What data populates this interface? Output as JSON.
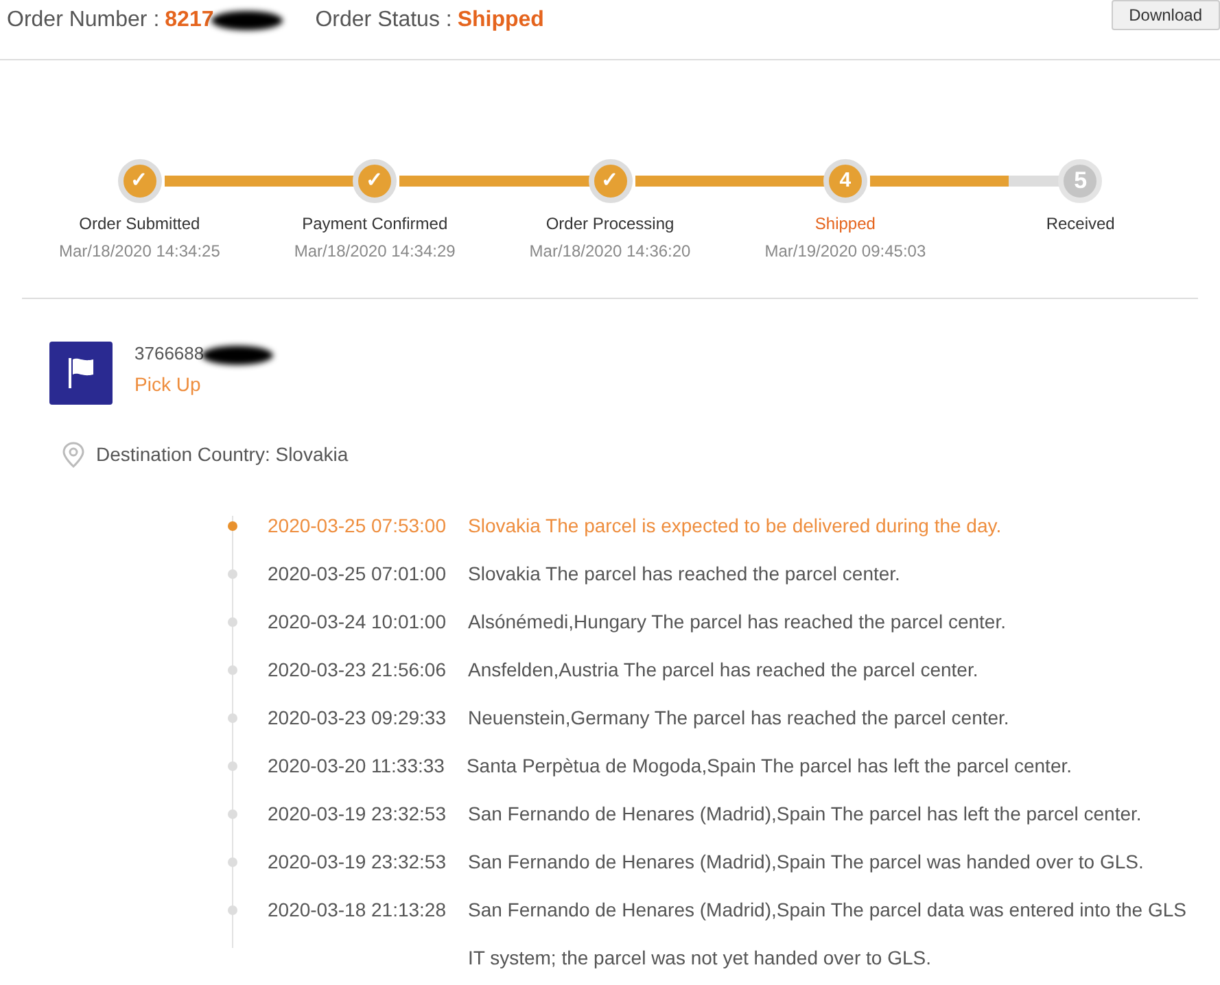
{
  "header": {
    "order_number_label": "Order Number :",
    "order_number": "8217",
    "order_status_label": "Order Status :",
    "order_status": "Shipped",
    "download_button": "Download"
  },
  "progress": {
    "steps": [
      {
        "marker": "✓",
        "label": "Order Submitted",
        "time": "Mar/18/2020 14:34:25",
        "selected": false
      },
      {
        "marker": "✓",
        "label": "Payment Confirmed",
        "time": "Mar/18/2020 14:34:29",
        "selected": false
      },
      {
        "marker": "✓",
        "label": "Order Processing",
        "time": "Mar/18/2020 14:36:20",
        "selected": false
      },
      {
        "marker": "4",
        "label": "Shipped",
        "time": "Mar/19/2020 09:45:03",
        "selected": true
      },
      {
        "marker": "5",
        "label": "Received",
        "selected": false
      }
    ]
  },
  "shipment": {
    "tracking_number": "3766688",
    "carrier": "Pick Up",
    "destination": "Destination Country: Slovakia"
  },
  "events": [
    {
      "time": "2020-03-25 07:53:00",
      "message": "Slovakia The parcel is expected to be delivered during the day.",
      "selected": true
    },
    {
      "time": "2020-03-25 07:01:00",
      "message": "Slovakia The parcel has reached the parcel center.",
      "selected": false
    },
    {
      "time": "2020-03-24 10:01:00",
      "message": "Alsónémedi,Hungary The parcel has reached the parcel center.",
      "selected": false
    },
    {
      "time": "2020-03-23 21:56:06",
      "message": "Ansfelden,Austria The parcel has reached the parcel center.",
      "selected": false
    },
    {
      "time": "2020-03-23 09:29:33",
      "message": "Neuenstein,Germany The parcel has reached the parcel center.",
      "selected": false
    },
    {
      "time": "2020-03-20 11:33:33",
      "message": "Santa Perpètua de Mogoda,Spain The parcel has left the parcel center.",
      "selected": false
    },
    {
      "time": "2020-03-19 23:32:53",
      "message": "San Fernando de Henares (Madrid),Spain The parcel has left the parcel center.",
      "selected": false
    },
    {
      "time": "2020-03-19 23:32:53",
      "message": "San Fernando de Henares (Madrid),Spain The parcel was handed over to GLS.",
      "selected": false
    },
    {
      "time": "2020-03-18 21:13:28",
      "message": "San Fernando de Henares (Madrid),Spain The parcel data was entered into the GLS IT system; the parcel was not yet handed over to GLS.",
      "selected": false
    }
  ]
}
